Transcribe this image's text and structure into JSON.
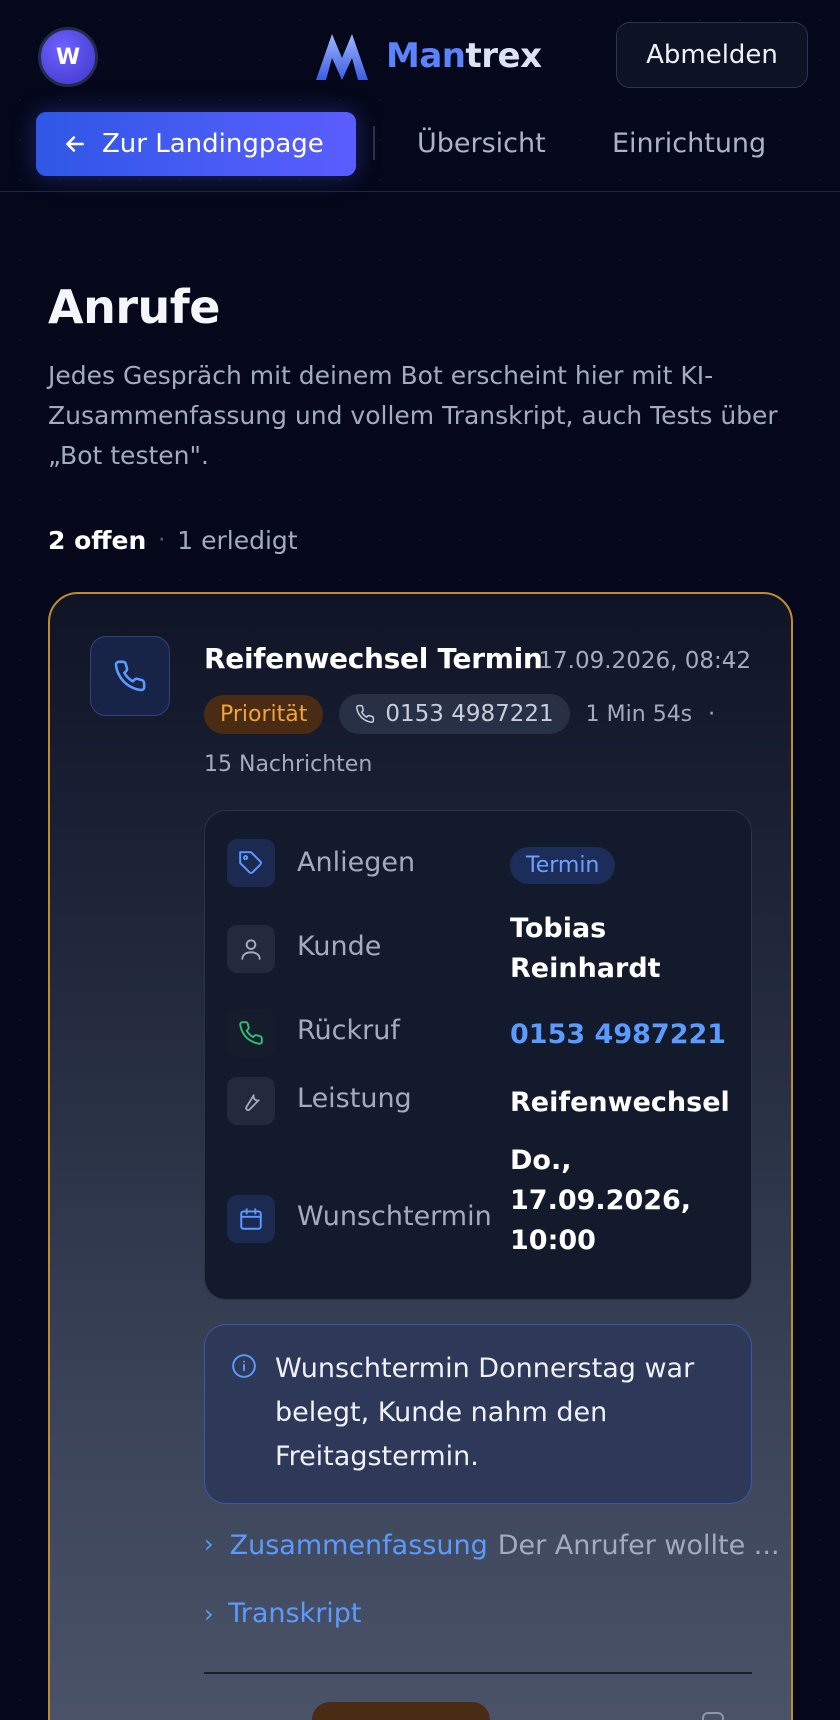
{
  "header": {
    "avatar_initial": "W",
    "logo_part1": "Man",
    "logo_part2": "trex",
    "logout_label": "Abmelden"
  },
  "nav": {
    "back_label": "Zur Landingpage",
    "items": [
      "Übersicht",
      "Einrichtung"
    ]
  },
  "page": {
    "title": "Anrufe",
    "description": "Jedes Gespräch mit deinem Bot erscheint hier mit KI-Zusammenfassung und vollem Transkript, auch Tests über „Bot testen\".",
    "open_count": "2 offen",
    "separator": "·",
    "done_count": "1 erledigt"
  },
  "call": {
    "title": "Reifenwechsel Termin",
    "datetime": "17.09.2026, 08:42",
    "priority": "Priorität",
    "phone": "0153 4987221",
    "duration": "1 Min 54s",
    "meta_separator": "·",
    "messages": "15 Nachrichten",
    "details": {
      "anliegen_label": "Anliegen",
      "anliegen_value": "Termin",
      "kunde_label": "Kunde",
      "kunde_value": "Tobias Reinhardt",
      "rueckruf_label": "Rückruf",
      "rueckruf_value": "0153 4987221",
      "leistung_label": "Leistung",
      "leistung_value": "Reifenwechsel",
      "wunschtermin_label": "Wunschtermin",
      "wunschtermin_value": "Do., 17.09.2026, 10:00"
    },
    "note": "Wunschtermin Donnerstag war belegt, Kunde nahm den Freitagstermin.",
    "summary_label": "Zusammenfassung",
    "summary_preview": "Der Anrufer wollte ...",
    "transcript_label": "Transkript"
  },
  "colors": {
    "accent": "#5b9bff",
    "brand": "#4a5cf5",
    "priority_bg": "#4a2b13",
    "priority_text": "#f0a43a",
    "card_border": "#c18a2c"
  },
  "icons": {
    "back": "arrow-left-icon",
    "call": "phone-icon",
    "anliegen": "tag-icon",
    "kunde": "user-icon",
    "rueckruf": "phone-icon",
    "leistung": "wrench-icon",
    "wunschtermin": "calendar-icon",
    "note": "info-icon"
  }
}
